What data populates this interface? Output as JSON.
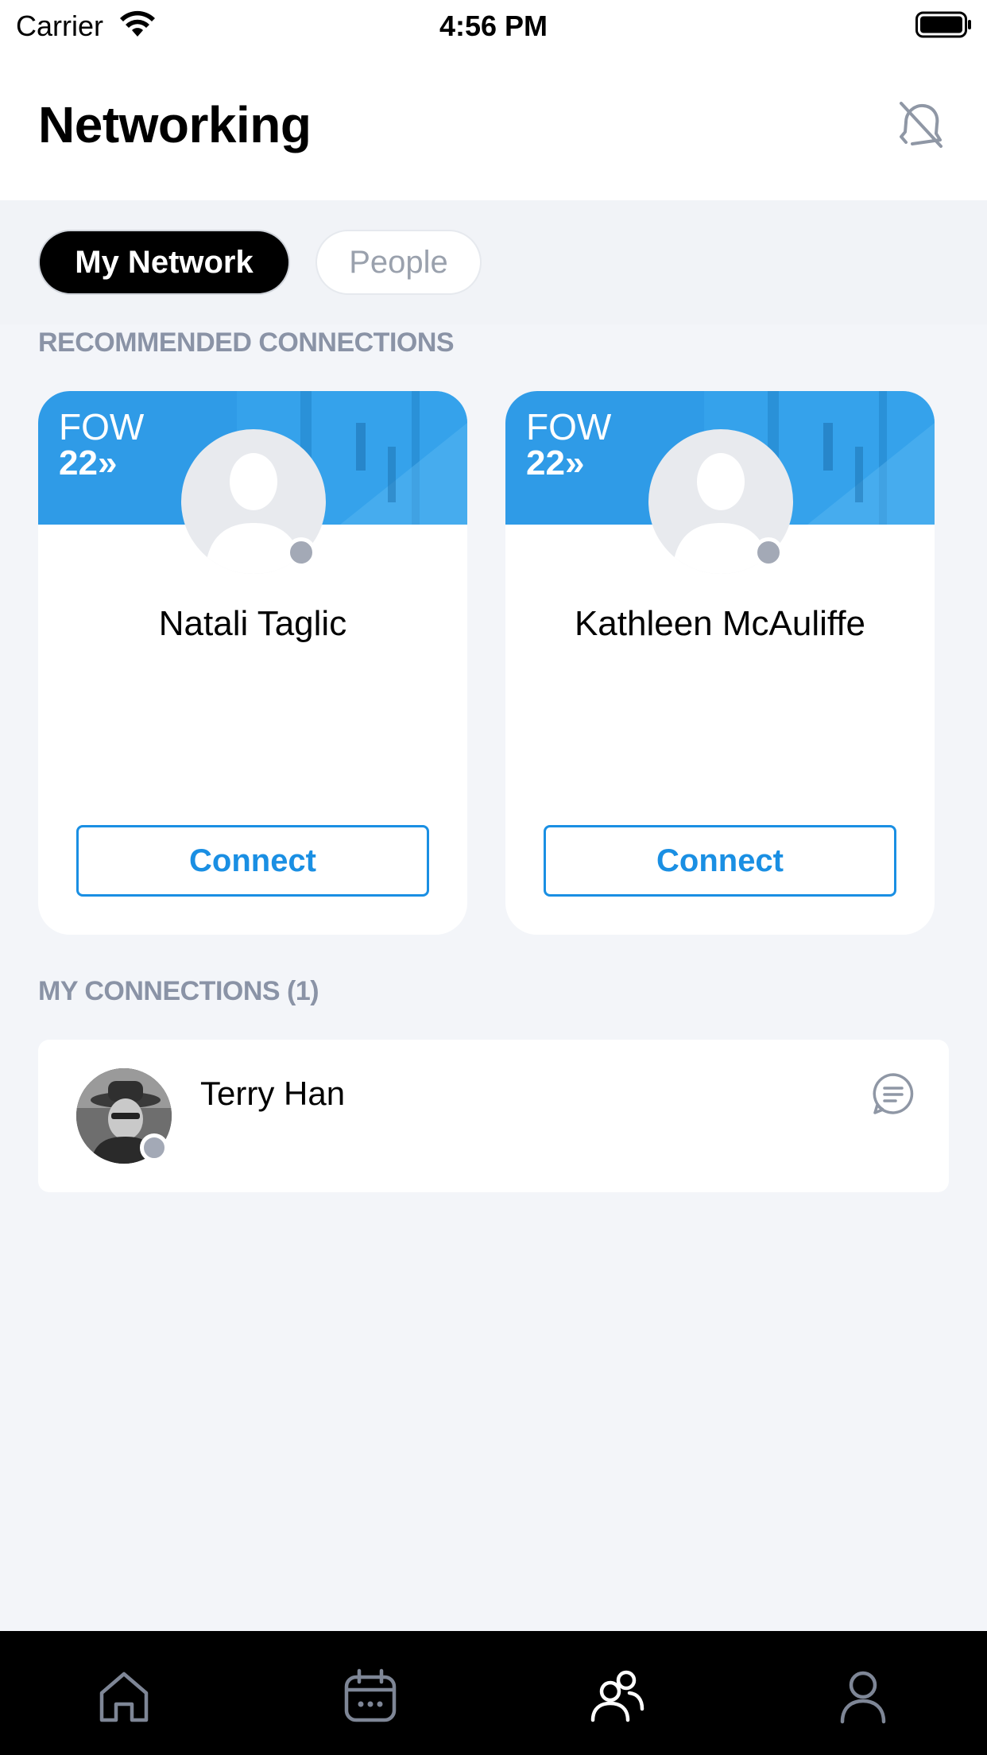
{
  "status_bar": {
    "carrier": "Carrier",
    "time": "4:56 PM"
  },
  "header": {
    "title": "Networking",
    "notification_icon": "bell-off-icon"
  },
  "tabs": [
    {
      "label": "My Network",
      "active": true
    },
    {
      "label": "People",
      "active": false
    }
  ],
  "recommended": {
    "section_title": "RECOMMENDED CONNECTIONS",
    "cards": [
      {
        "banner_line1": "FOW",
        "banner_line2": "22»",
        "name": "Natali Taglic",
        "button": "Connect"
      },
      {
        "banner_line1": "FOW",
        "banner_line2": "22»",
        "name": "Kathleen McAuliffe",
        "button": "Connect"
      }
    ]
  },
  "connections": {
    "section_title": "MY CONNECTIONS (1)",
    "items": [
      {
        "name": "Terry Han",
        "action_icon": "chat-icon"
      }
    ]
  },
  "tab_bar": {
    "items": [
      {
        "icon": "home-icon",
        "active": false
      },
      {
        "icon": "calendar-icon",
        "active": false
      },
      {
        "icon": "people-icon",
        "active": true
      },
      {
        "icon": "profile-icon",
        "active": false
      }
    ]
  },
  "colors": {
    "accent": "#1a8fe3",
    "banner": "#2f9be7",
    "tab_active_bg": "#000000",
    "tab_bar_bg": "#000000",
    "section_title": "#8a93a6"
  }
}
